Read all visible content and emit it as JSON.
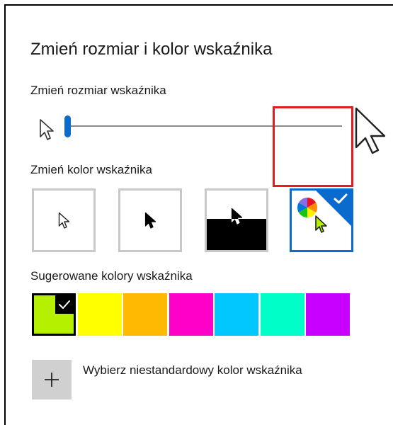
{
  "page": {
    "title": "Zmień rozmiar i kolor wskaźnika"
  },
  "size_section": {
    "label": "Zmień rozmiar wskaźnika",
    "slider_value_fraction": 0.0
  },
  "color_section": {
    "label": "Zmień kolor wskaźnika",
    "options": [
      {
        "name": "white",
        "icon": "white-pointer-icon",
        "selected": false
      },
      {
        "name": "black",
        "icon": "black-pointer-icon",
        "selected": false
      },
      {
        "name": "inverted",
        "icon": "inverted-pointer-icon",
        "selected": false
      },
      {
        "name": "custom",
        "icon": "color-wheel-pointer-icon",
        "selected": true
      }
    ]
  },
  "suggested_section": {
    "label": "Sugerowane kolory wskaźnika",
    "colors": [
      "#b4f000",
      "#ffff00",
      "#ffb900",
      "#ff00c8",
      "#00c8ff",
      "#00ffc8",
      "#c800ff"
    ],
    "selected_index": 0
  },
  "custom_color": {
    "button_icon": "plus-icon",
    "label": "Wybierz niestandardowy kolor wskaźnika"
  },
  "colors": {
    "accent": "#0a6acd",
    "highlight": "#e01e1e",
    "selected_pointer": "#b4f000"
  }
}
